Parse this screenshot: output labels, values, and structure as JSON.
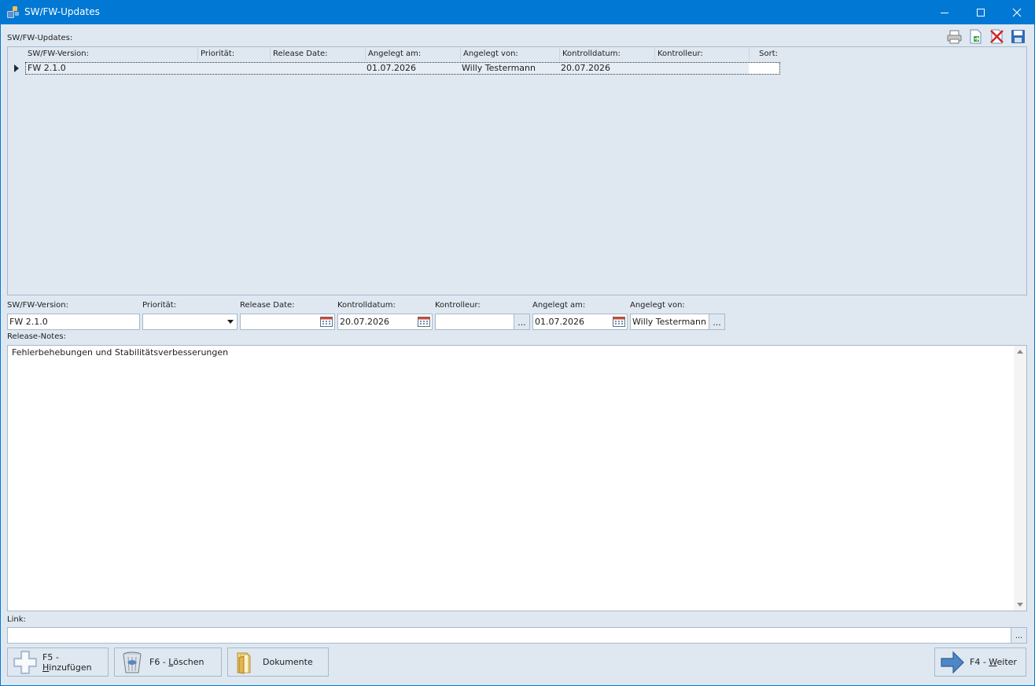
{
  "window": {
    "title": "SW/FW-Updates"
  },
  "list": {
    "label": "SW/FW-Updates:",
    "columns": [
      "SW/FW-Version:",
      "Priorität:",
      "Release Date:",
      "Angelegt am:",
      "Angelegt von:",
      "Kontrolldatum:",
      "Kontrolleur:",
      "Sort:"
    ],
    "rows": [
      {
        "version": "FW 2.1.0",
        "prioritaet": "",
        "release_date": "",
        "angelegt_am": "01.07.2026",
        "angelegt_von": "Willy Testermann",
        "kontrolldatum": "20.07.2026",
        "kontrolleur": "",
        "sort": ""
      }
    ]
  },
  "toolbar_icons": [
    "printer-icon",
    "export-icon",
    "delete-icon",
    "save-icon"
  ],
  "form": {
    "version": {
      "label": "SW/FW-Version:",
      "value": "FW 2.1.0"
    },
    "prioritaet": {
      "label": "Priorität:",
      "value": ""
    },
    "release_date": {
      "label": "Release Date:",
      "value": ""
    },
    "kontrolldatum": {
      "label": "Kontrolldatum:",
      "value": "20.07.2026"
    },
    "kontrolleur": {
      "label": "Kontrolleur:",
      "value": "",
      "button": "..."
    },
    "angelegt_am": {
      "label": "Angelegt am:",
      "value": "01.07.2026"
    },
    "angelegt_von": {
      "label": "Angelegt von:",
      "value": "Willy Testermann",
      "button": "..."
    },
    "release_notes": {
      "label": "Release-Notes:",
      "value": "Fehlerbehebungen und Stabilitätsverbesserungen"
    },
    "link": {
      "label": "Link:",
      "value": "",
      "button": "..."
    }
  },
  "buttons": {
    "add": {
      "prefix": "F5 - ",
      "hot": "H",
      "rest": "inzufügen"
    },
    "delete": {
      "prefix": "F6 - ",
      "hot": "L",
      "rest": "öschen"
    },
    "documents": {
      "label": "Dokumente"
    },
    "next": {
      "prefix": "F4 - ",
      "hot": "W",
      "rest": "eiter"
    }
  }
}
